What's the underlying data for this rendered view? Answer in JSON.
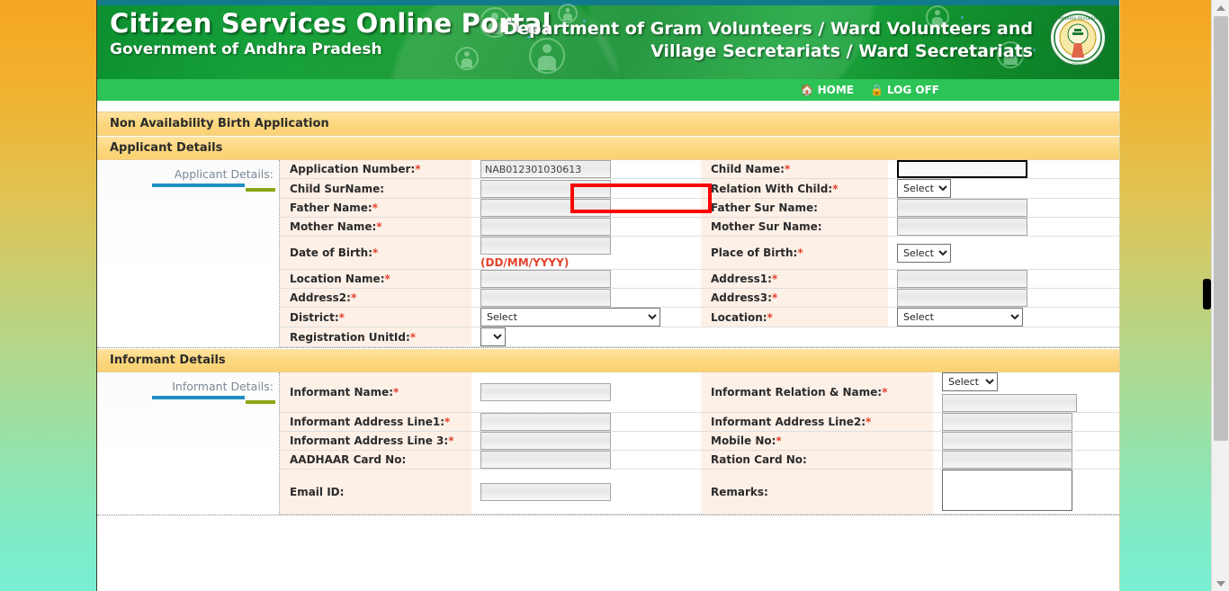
{
  "header": {
    "site_title": "Citizen Services Online Portal",
    "site_subtitle": "Government of Andhra Pradesh",
    "dept_line1": "Department of Gram Volunteers / Ward Volunteers and",
    "dept_line2": "Village Secretariats / Ward Secretariats",
    "emblem_name": "andhra-pradesh-emblem"
  },
  "nav": {
    "home": "HOME",
    "home_icon": "home-icon",
    "logoff": "LOG OFF",
    "logoff_icon": "lock-icon"
  },
  "page": {
    "title": "Non Availability Birth Application"
  },
  "applicant": {
    "section_title": "Applicant Details",
    "side_label": "Applicant Details:",
    "rows": [
      {
        "left_label": "Application Number:",
        "left_required": true,
        "left_type": "text",
        "left_value": "NAB012301030613",
        "left_readonly": true,
        "right_label": "Child Name:",
        "right_required": true,
        "right_type": "text",
        "right_value": "",
        "right_focused": true
      },
      {
        "left_label": "Child SurName:",
        "left_required": false,
        "left_type": "text",
        "left_value": "",
        "left_highlighted": true,
        "right_label": "Relation With Child:",
        "right_required": true,
        "right_type": "select",
        "right_value": "Select"
      },
      {
        "left_label": "Father Name:",
        "left_required": true,
        "left_type": "text",
        "left_value": "",
        "right_label": "Father Sur Name:",
        "right_required": false,
        "right_type": "text",
        "right_value": ""
      },
      {
        "left_label": "Mother Name:",
        "left_required": true,
        "left_type": "text",
        "left_value": "",
        "right_label": "Mother Sur Name:",
        "right_required": false,
        "right_type": "text",
        "right_value": ""
      },
      {
        "left_label": "Date of Birth:",
        "left_required": true,
        "left_type": "text",
        "left_value": "",
        "left_hint": "(DD/MM/YYYY)",
        "right_label": "Place of Birth:",
        "right_required": true,
        "right_type": "select",
        "right_value": "Select"
      },
      {
        "left_label": "Location Name:",
        "left_required": true,
        "left_type": "text",
        "left_value": "",
        "right_label": "Address1:",
        "right_required": true,
        "right_type": "text",
        "right_value": ""
      },
      {
        "left_label": "Address2:",
        "left_required": true,
        "left_type": "text",
        "left_value": "",
        "right_label": "Address3:",
        "right_required": true,
        "right_type": "text",
        "right_value": ""
      },
      {
        "left_label": "District:",
        "left_required": true,
        "left_type": "select-wide",
        "left_value": "Select",
        "right_label": "Location:",
        "right_required": true,
        "right_type": "select-mid",
        "right_value": "Select"
      },
      {
        "left_label": "Registration UnitId:",
        "left_required": true,
        "left_type": "select-tiny",
        "left_value": "",
        "right_label": "",
        "right_required": false,
        "right_type": "none",
        "right_value": ""
      }
    ]
  },
  "informant": {
    "section_title": "Informant Details",
    "side_label": "Informant Details:",
    "rows": [
      {
        "left_label": "Informant Name:",
        "left_required": true,
        "left_type": "text",
        "left_value": "",
        "right_label": "Informant Relation & Name:",
        "right_required": true,
        "right_type": "select-plus-text",
        "right_value": "Select",
        "right_value2": ""
      },
      {
        "left_label": "Informant Address Line1:",
        "left_required": true,
        "left_type": "text",
        "left_value": "",
        "right_label": "Informant Address Line2:",
        "right_required": true,
        "right_type": "text",
        "right_value": ""
      },
      {
        "left_label": "Informant Address Line 3:",
        "left_required": true,
        "left_type": "text",
        "left_value": "",
        "right_label": "Mobile No:",
        "right_required": true,
        "right_type": "text",
        "right_value": ""
      },
      {
        "left_label": "AADHAAR Card No:",
        "left_required": false,
        "left_type": "text",
        "left_value": "",
        "right_label": "Ration Card No:",
        "right_required": false,
        "right_type": "text",
        "right_value": ""
      },
      {
        "left_label": "Email ID:",
        "left_required": false,
        "left_type": "text",
        "left_value": "",
        "right_label": "Remarks:",
        "right_required": false,
        "right_type": "textarea",
        "right_value": ""
      }
    ]
  },
  "scrollbar": {
    "up_icon": "scroll-up-arrow",
    "down_icon": "scroll-down-arrow"
  },
  "colors": {
    "banner_green": "#16a03a",
    "nav_green": "#2dc457",
    "section_yellow": "#fcd77f",
    "label_peach": "#fdf0e7",
    "required_red": "#e2422c",
    "highlight_red": "#ff0000",
    "rule_blue": "#1f8fc4",
    "rule_green": "#8aa617",
    "top_rule_teal": "#117b8c"
  }
}
